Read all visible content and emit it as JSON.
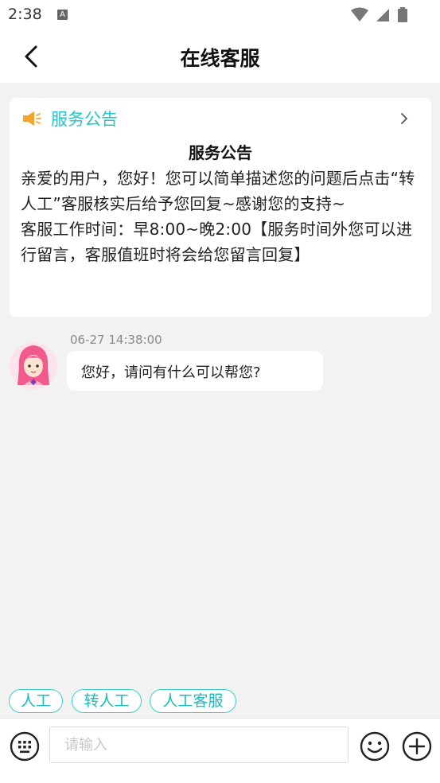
{
  "status_bar": {
    "time": "2:38",
    "notification_icon": "a-icon",
    "right_icons": [
      "wifi-icon",
      "signal-icon",
      "battery-icon"
    ]
  },
  "app_bar": {
    "back_icon": "chevron-left-icon",
    "title": "在线客服"
  },
  "notice": {
    "header_icon": "speaker-icon",
    "header_label": "服务公告",
    "header_chevron": "chevron-right-icon",
    "title": "服务公告",
    "body_line1": "亲爱的用户，您好！您可以简单描述您的问题后点击“转人工”客服核实后给予您回复~感谢您的支持~",
    "body_line2": "客服工作时间：早8:00~晚2:00【服务时间外您可以进行留言，客服值班时将会给您留言回复】"
  },
  "message": {
    "timestamp": "06-27 14:38:00",
    "avatar": "agent-avatar",
    "text": "您好，请问有什么可以帮您?"
  },
  "quick_replies": [
    "人工",
    "转人工",
    "人工客服"
  ],
  "input_bar": {
    "keyboard_icon": "keyboard-icon",
    "placeholder": "请输入",
    "emoji_icon": "smiley-icon",
    "plus_icon": "plus-circle-icon"
  },
  "colors": {
    "accent": "#21c7c7",
    "background": "#f2f2f2"
  }
}
